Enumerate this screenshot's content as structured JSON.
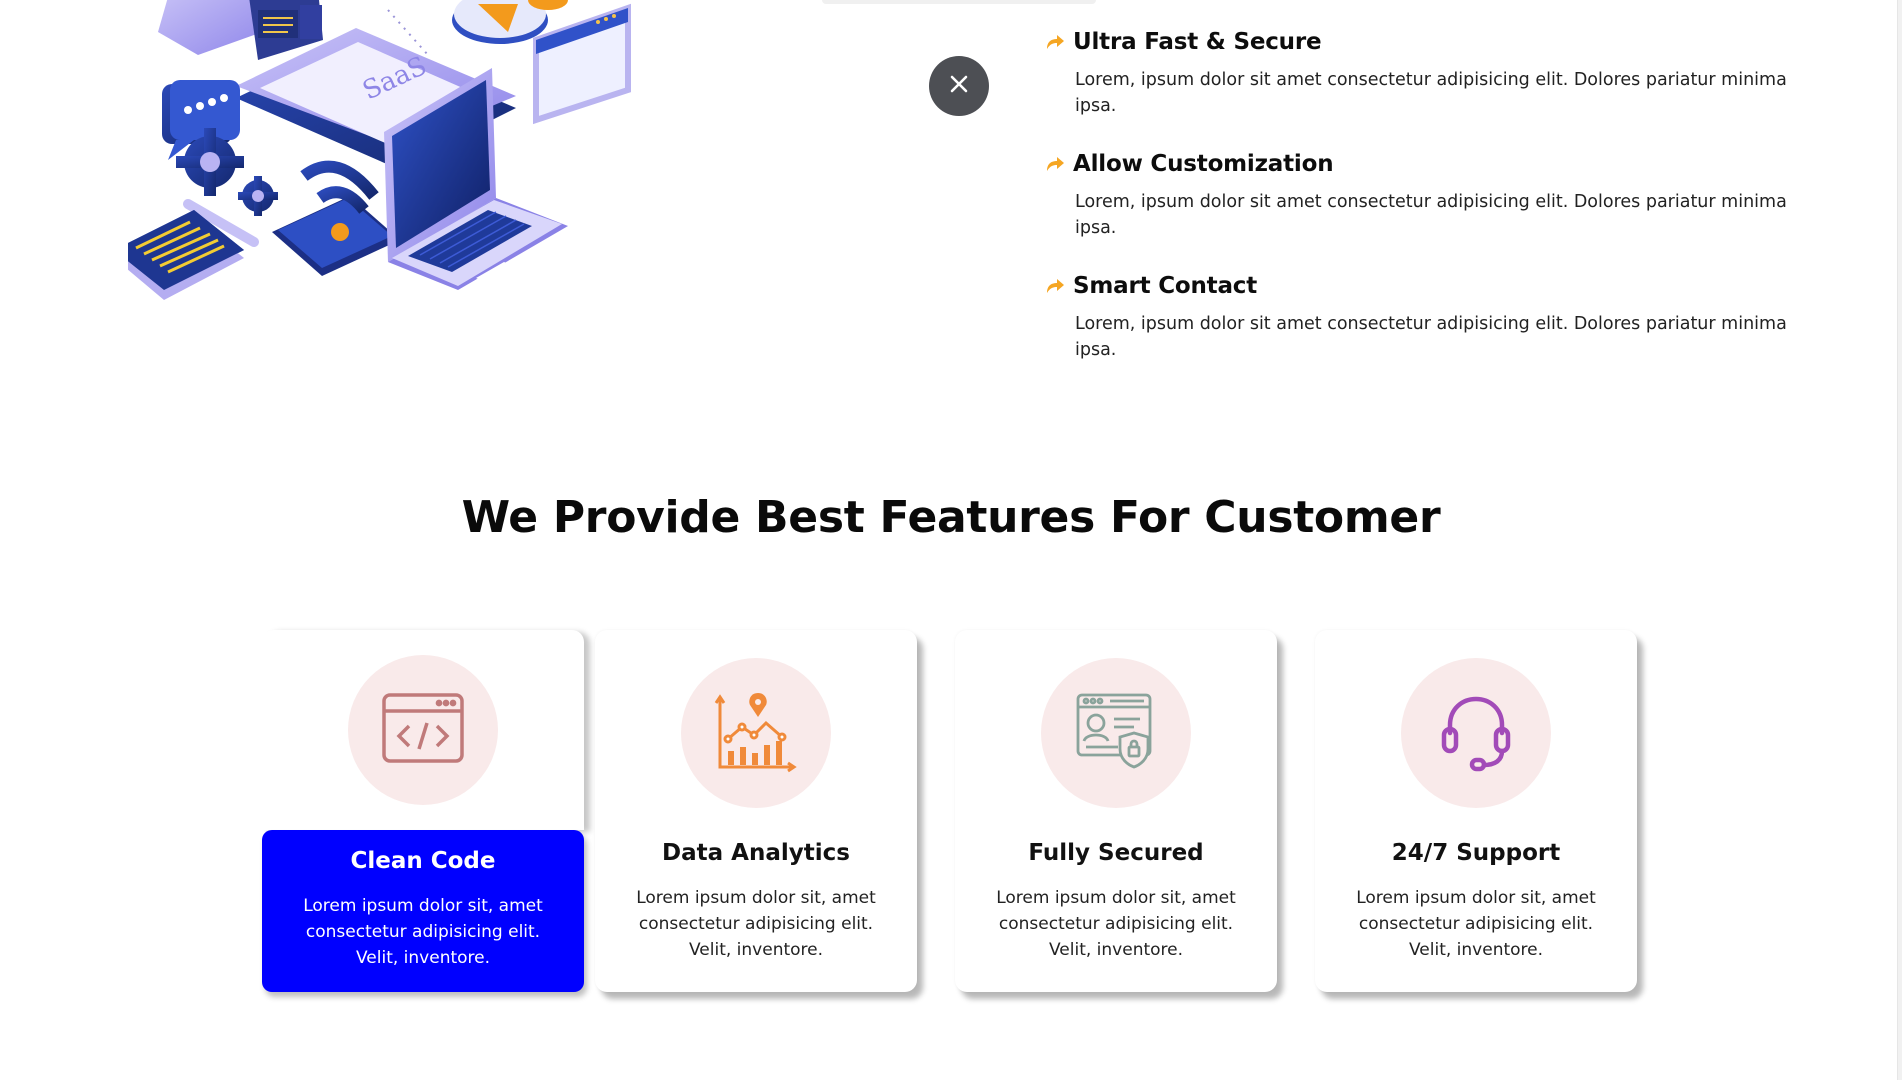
{
  "features": [
    {
      "title": "Ultra Fast & Secure",
      "desc": "Lorem, ipsum dolor sit amet consectetur adipisicing elit. Dolores pariatur minima ipsa."
    },
    {
      "title": "Allow Customization",
      "desc": "Lorem, ipsum dolor sit amet consectetur adipisicing elit. Dolores pariatur minima ipsa."
    },
    {
      "title": "Smart Contact",
      "desc": "Lorem, ipsum dolor sit amet consectetur adipisicing elit. Dolores pariatur minima ipsa."
    }
  ],
  "illustration": {
    "label": "SaaS"
  },
  "section": {
    "title": "We Provide Best Features For Customer"
  },
  "cards": [
    {
      "title": "Clean Code",
      "desc": "Lorem ipsum dolor sit, amet consectetur adipisicing elit. Velit, inventore.",
      "icon": "code-window-icon"
    },
    {
      "title": "Data Analytics",
      "desc": "Lorem ipsum dolor sit, amet consectetur adipisicing elit. Velit, inventore.",
      "icon": "analytics-chart-icon"
    },
    {
      "title": "Fully Secured",
      "desc": "Lorem ipsum dolor sit, amet consectetur adipisicing elit. Velit, inventore.",
      "icon": "secure-profile-icon"
    },
    {
      "title": "24/7 Support",
      "desc": "Lorem ipsum dolor sit, amet consectetur adipisicing elit. Velit, inventore.",
      "icon": "headset-icon"
    }
  ],
  "colors": {
    "accent_blue": "#0000ff",
    "arrow_orange": "#f5a623",
    "icon_circle": "#f9eaea"
  }
}
